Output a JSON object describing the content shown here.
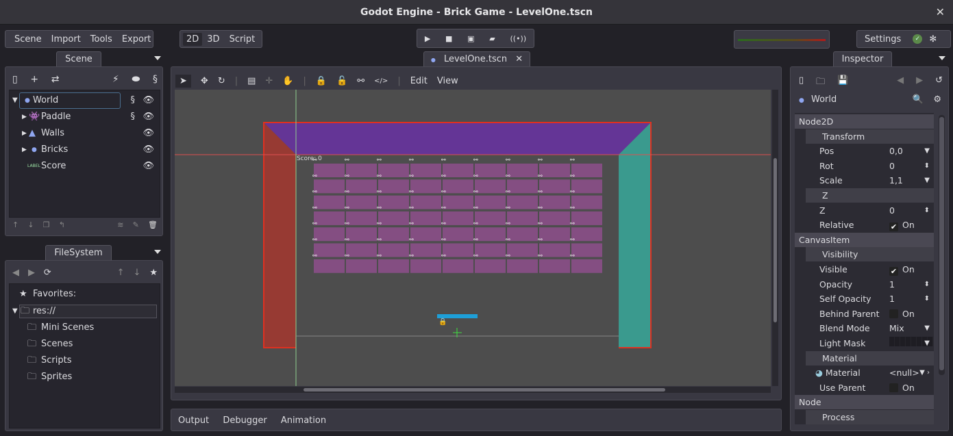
{
  "window": {
    "title": "Godot Engine - Brick Game - LevelOne.tscn",
    "close_icon": "close-icon"
  },
  "main_menu": [
    "Scene",
    "Import",
    "Tools",
    "Export"
  ],
  "workspaces": [
    "2D",
    "3D",
    "Script"
  ],
  "active_workspace": "2D",
  "play_controls": [
    "play-icon",
    "stop-icon",
    "play-scene-icon",
    "play-custom-icon",
    "remote-debug-icon"
  ],
  "settings": {
    "label": "Settings",
    "update_icon": "check-icon",
    "spinner_icon": "spinner-icon"
  },
  "scene_dock": {
    "tab": "Scene",
    "toolbar_icons": [
      "new-scene-icon",
      "add-node-icon",
      "instance-icon",
      "connect-icon",
      "groups-icon",
      "script-icon"
    ],
    "tree": [
      {
        "label": "World",
        "icon": "node2d-icon",
        "expanded": true,
        "script": true,
        "selected": true
      },
      {
        "label": "Paddle",
        "icon": "sprite-icon",
        "script": true
      },
      {
        "label": "Walls",
        "icon": "polygon-icon"
      },
      {
        "label": "Bricks",
        "icon": "node2d-icon"
      },
      {
        "label": "Score",
        "icon": "label-icon",
        "badge": "LABEL"
      }
    ]
  },
  "filesystem": {
    "tab": "FileSystem",
    "favorites": "Favorites:",
    "root": "res://",
    "folders": [
      "Mini Scenes",
      "Scenes",
      "Scripts",
      "Sprites"
    ]
  },
  "editor": {
    "scene_tab": "LevelOne.tscn",
    "menus": [
      "Edit",
      "View"
    ],
    "score_label": "Score: 0"
  },
  "bottom_panel": [
    "Output",
    "Debugger",
    "Animation"
  ],
  "inspector": {
    "tab": "Inspector",
    "node": "World",
    "rows": [
      {
        "kind": "sec",
        "label": "Node2D"
      },
      {
        "kind": "sub",
        "label": "Transform"
      },
      {
        "kind": "prop",
        "label": "Pos",
        "value": "0,0",
        "ctrl": "drop"
      },
      {
        "kind": "prop",
        "label": "Rot",
        "value": "0",
        "ctrl": "spin"
      },
      {
        "kind": "prop",
        "label": "Scale",
        "value": "1,1",
        "ctrl": "drop"
      },
      {
        "kind": "sub",
        "label": "Z"
      },
      {
        "kind": "prop",
        "label": "Z",
        "value": "0",
        "ctrl": "spin"
      },
      {
        "kind": "prop",
        "label": "Relative",
        "value": "On",
        "ctrl": "check",
        "checked": true
      },
      {
        "kind": "sec",
        "label": "CanvasItem"
      },
      {
        "kind": "sub",
        "label": "Visibility"
      },
      {
        "kind": "prop",
        "label": "Visible",
        "value": "On",
        "ctrl": "check",
        "checked": true
      },
      {
        "kind": "prop",
        "label": "Opacity",
        "value": "1",
        "ctrl": "spin"
      },
      {
        "kind": "prop",
        "label": "Self Opacity",
        "value": "1",
        "ctrl": "spin"
      },
      {
        "kind": "prop",
        "label": "Behind Parent",
        "value": "On",
        "ctrl": "check",
        "checked": false
      },
      {
        "kind": "prop",
        "label": "Blend Mode",
        "value": "Mix",
        "ctrl": "drop"
      },
      {
        "kind": "prop",
        "label": "Light Mask",
        "value": "",
        "ctrl": "mask"
      },
      {
        "kind": "sub",
        "label": "Material"
      },
      {
        "kind": "prop",
        "label": "Material",
        "value": "<null>",
        "ctrl": "res"
      },
      {
        "kind": "prop",
        "label": "Use Parent",
        "value": "On",
        "ctrl": "check",
        "checked": false
      },
      {
        "kind": "sec",
        "label": "Node"
      },
      {
        "kind": "sub",
        "label": "Process"
      }
    ]
  },
  "colors": {
    "wall_top": "#643596",
    "wall_left": "#973a33",
    "wall_right": "#3a9a8e",
    "brick": "#844e82",
    "paddle": "#1e9fd8",
    "canvas": "#4d4d4d",
    "accent": "#8fa6f0"
  }
}
